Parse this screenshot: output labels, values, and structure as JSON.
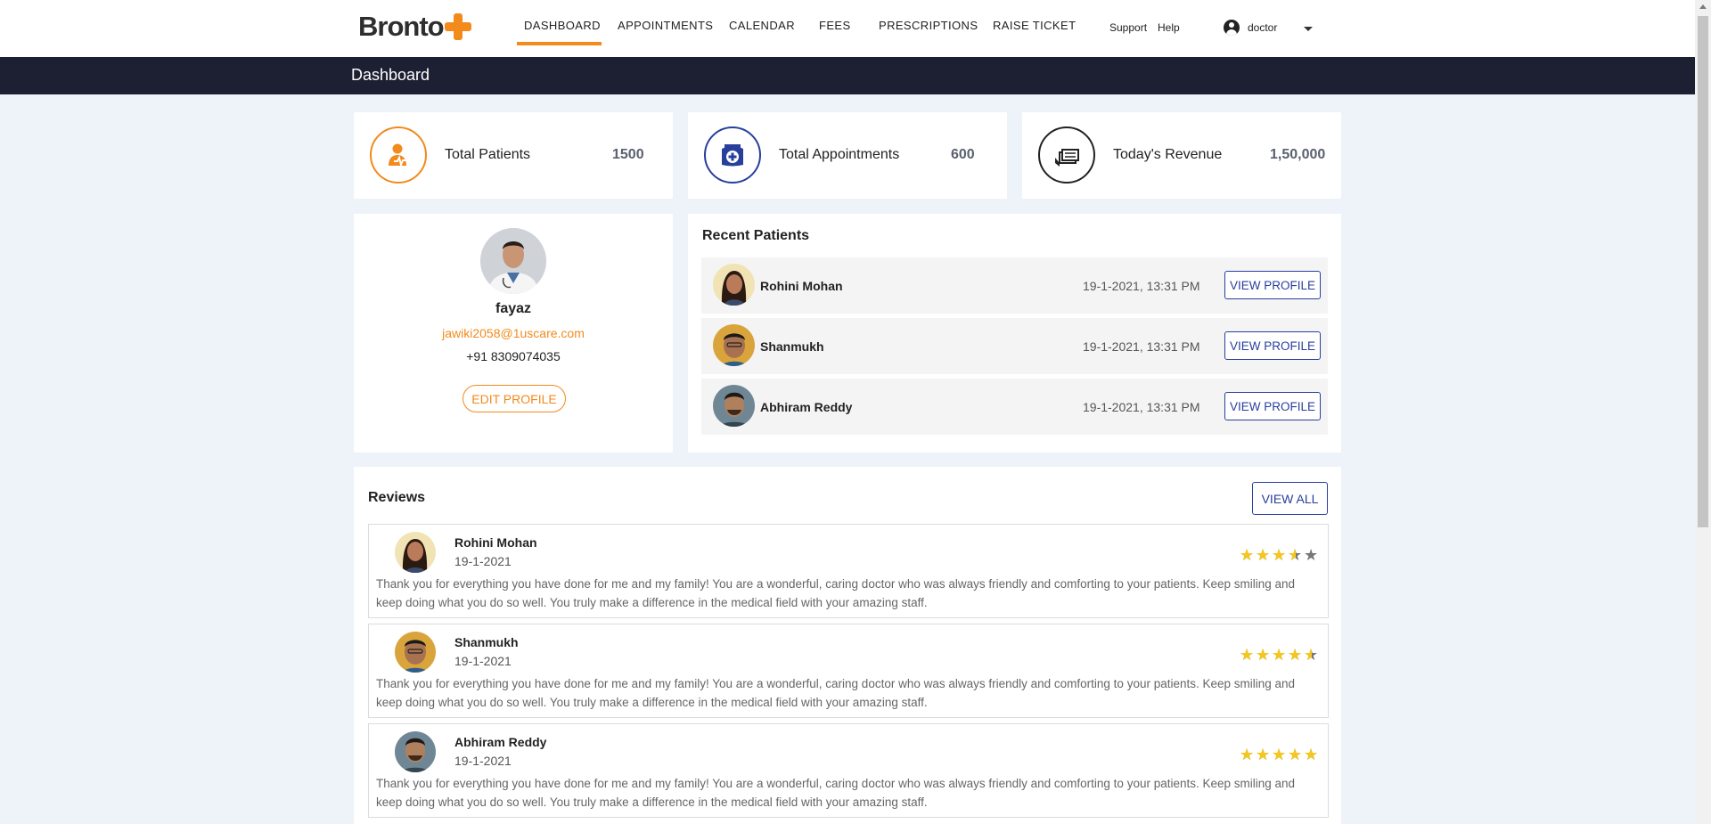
{
  "app": {
    "logo_text": "Bronto",
    "colors": {
      "accent": "#f28a1c",
      "nav_dark": "#1d1f33",
      "link_blue": "#283f9c",
      "star": "#f5c71a"
    }
  },
  "nav": {
    "items": [
      "DASHBOARD",
      "APPOINTMENTS",
      "CALENDAR",
      "FEES",
      "PRESCRIPTIONS",
      "RAISE TICKET"
    ],
    "active": "DASHBOARD",
    "support": "Support",
    "help": "Help",
    "user": "doctor"
  },
  "page_title": "Dashboard",
  "stats": [
    {
      "label": "Total Patients",
      "value": "1500",
      "icon": "patient-icon"
    },
    {
      "label": "Total Appointments",
      "value": "600",
      "icon": "appointment-calendar-icon"
    },
    {
      "label": "Today's Revenue",
      "value": "1,50,000",
      "icon": "revenue-cash-icon"
    }
  ],
  "profile": {
    "name": "fayaz",
    "email": "jawiki2058@1uscare.com",
    "phone": "+91 8309074035",
    "edit_label": "EDIT PROFILE"
  },
  "recent_patients": {
    "title": "Recent Patients",
    "button_label": "VIEW PROFILE",
    "rows": [
      {
        "name": "Rohini Mohan",
        "time": "19-1-2021, 13:31 PM"
      },
      {
        "name": "Shanmukh",
        "time": "19-1-2021, 13:31 PM"
      },
      {
        "name": "Abhiram Reddy",
        "time": "19-1-2021, 13:31 PM"
      }
    ]
  },
  "reviews": {
    "title": "Reviews",
    "view_all_label": "VIEW ALL",
    "items": [
      {
        "name": "Rohini Mohan",
        "date": "19-1-2021",
        "rating": 3.5,
        "text": "Thank you for everything you have done for me and my family! You are a wonderful, caring doctor who was always friendly and comforting to your patients. Keep smiling and keep doing what you do so well. You truly make a difference in the medical field with your amazing staff."
      },
      {
        "name": "Shanmukh",
        "date": "19-1-2021",
        "rating": 4.5,
        "text": "Thank you for everything you have done for me and my family! You are a wonderful, caring doctor who was always friendly and comforting to your patients. Keep smiling and keep doing what you do so well. You truly make a difference in the medical field with your amazing staff."
      },
      {
        "name": "Abhiram Reddy",
        "date": "19-1-2021",
        "rating": 5,
        "text": "Thank you for everything you have done for me and my family! You are a wonderful, caring doctor who was always friendly and comforting to your patients. Keep smiling and keep doing what you do so well. You truly make a difference in the medical field with your amazing staff."
      }
    ]
  }
}
